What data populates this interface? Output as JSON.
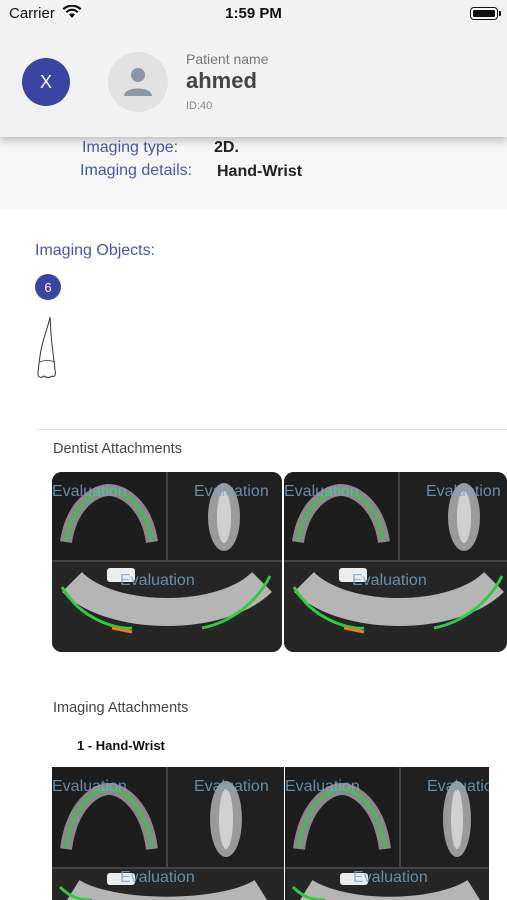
{
  "status_bar": {
    "carrier": "Carrier",
    "time": "1:59 PM"
  },
  "header": {
    "close_label": "X",
    "patient_name_label": "Patient name",
    "patient_name": "ahmed",
    "patient_id": "ID:40"
  },
  "imaging": {
    "type_label": "Imaging type:",
    "type_value": "2D.",
    "details_label": "Imaging details:",
    "details_value": "Hand-Wrist"
  },
  "objects": {
    "title": "Imaging Objects:",
    "count": "6"
  },
  "dentist_attachments": {
    "title": "Dentist Attachments",
    "thumbnails": [
      {
        "watermark": "Evaluation"
      },
      {
        "watermark": "Evaluation"
      }
    ]
  },
  "imaging_attachments": {
    "title": "Imaging Attachments",
    "items": [
      {
        "label": "1 - Hand-Wrist",
        "thumbnails": [
          {
            "watermark": "Evaluation"
          },
          {
            "watermark": "Evaluation"
          }
        ]
      }
    ]
  },
  "colors": {
    "accent": "#3a44a3",
    "label_blue": "#4a54ad",
    "header_bg": "#f2f2f2"
  }
}
